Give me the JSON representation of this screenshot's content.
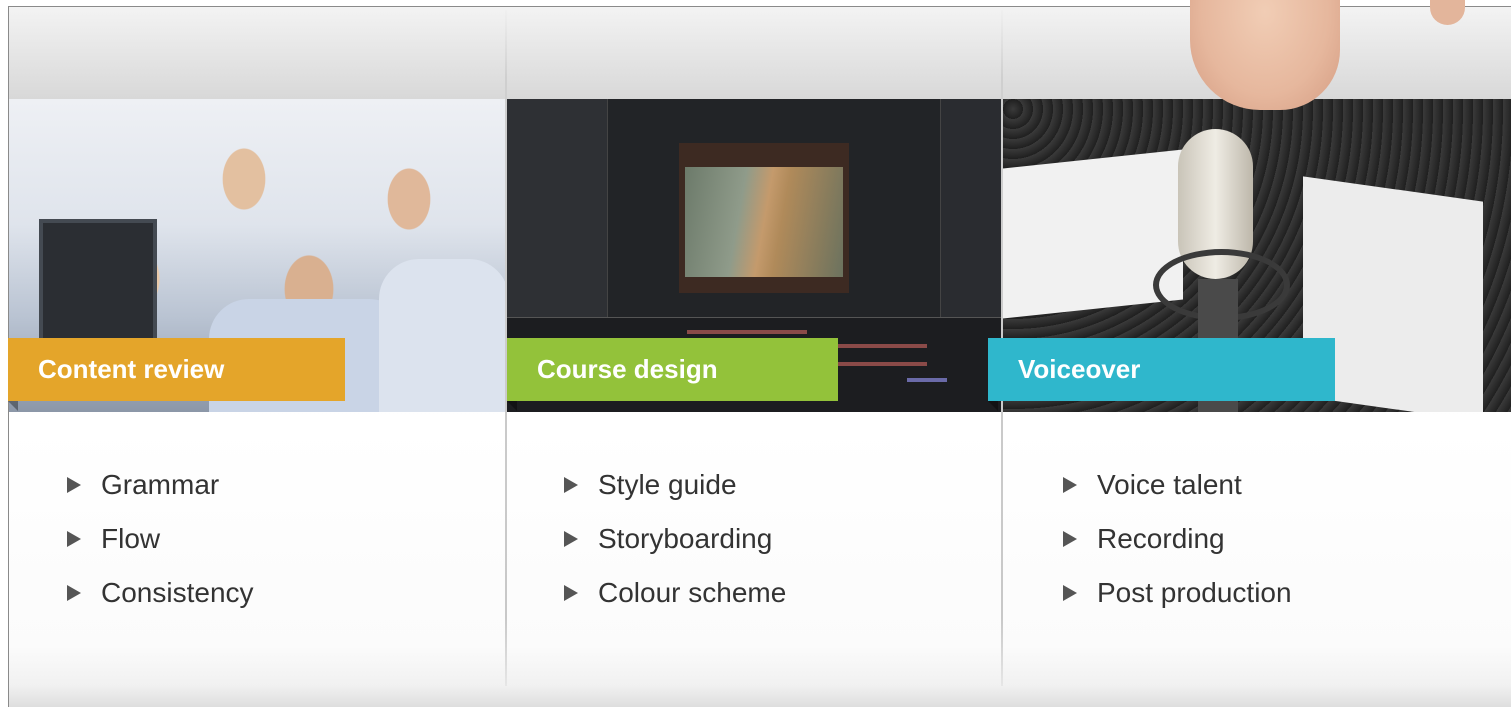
{
  "columns": [
    {
      "title": "Content review",
      "accent": "#e4a52a",
      "items": [
        "Grammar",
        "Flow",
        "Consistency"
      ]
    },
    {
      "title": "Course design",
      "accent": "#93c23a",
      "items": [
        "Style guide",
        "Storyboarding",
        "Colour scheme"
      ]
    },
    {
      "title": "Voiceover",
      "accent": "#2fb7cc",
      "items": [
        "Voice talent",
        "Recording",
        "Post production"
      ]
    }
  ],
  "icons": {
    "bullet": "triangle-right-icon"
  }
}
